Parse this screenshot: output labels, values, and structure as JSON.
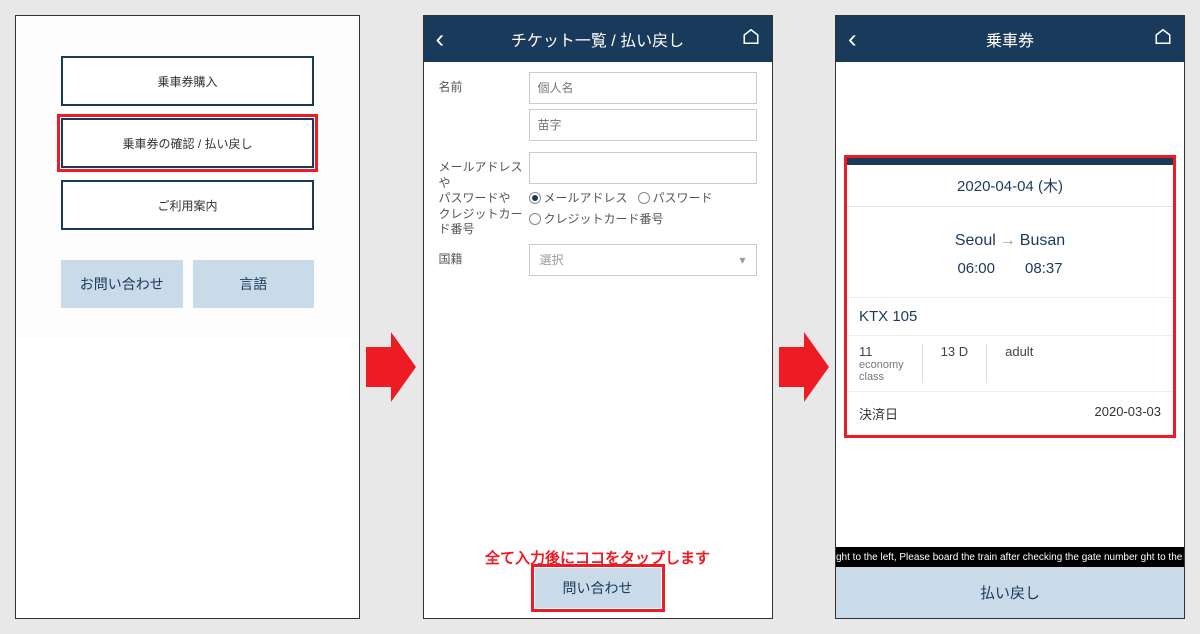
{
  "screen1": {
    "btn_purchase": "乗車券購入",
    "btn_confirm_refund": "乗車券の確認 / 払い戻し",
    "btn_guide": "ご利用案内",
    "btn_inquiry": "お問い合わせ",
    "btn_language": "言語"
  },
  "screen2": {
    "header_title": "チケット一覧 / 払い戻し",
    "label_name": "名前",
    "placeholder_firstname": "個人名",
    "placeholder_lastname": "苗字",
    "label_contact": "メールアドレスや\nパスワードや\nクレジットカード番号",
    "radio_email": "メールアドレス",
    "radio_password": "パスワード",
    "radio_credit": "クレジットカード番号",
    "label_country": "国籍",
    "select_placeholder": "選択",
    "annotation": "全て入力後にココをタップします",
    "btn_submit": "問い合わせ"
  },
  "screen3": {
    "header_title": "乗車券",
    "date_text": "2020-04-04 (木)",
    "origin": "Seoul",
    "destination": "Busan",
    "dep_time": "06:00",
    "arr_time": "08:37",
    "train": "KTX 105",
    "car": "11",
    "car_sub": "economy\nclass",
    "seat": "13 D",
    "passenger": "adult",
    "pay_label": "決済日",
    "pay_date": "2020-03-03",
    "marquee_text": "ght to the left, Please board the train after checking the gate number ght to the",
    "btn_refund": "払い戻し"
  }
}
